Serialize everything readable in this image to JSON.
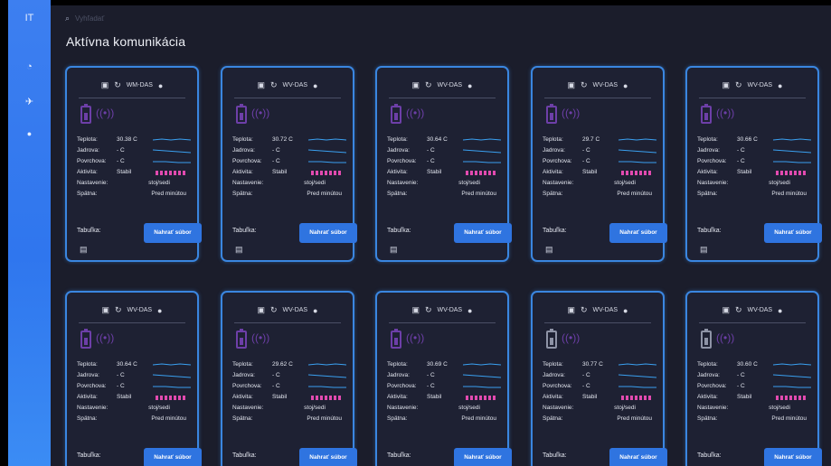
{
  "sidebar": {
    "logo": "IT",
    "items": [
      {
        "icon": "chart-icon",
        "glyph": "◔"
      },
      {
        "icon": "plane-icon",
        "glyph": "✈"
      },
      {
        "icon": "microphone-icon",
        "glyph": "●"
      }
    ]
  },
  "search": {
    "glyph": "⌕",
    "placeholder": "Vyhľadať"
  },
  "page_title": "Aktívna komunikácia",
  "labels": {
    "temp": "Teplota:",
    "jadrova": "Jadrova:",
    "povrchova": "Povrchova:",
    "aktivita": "Aktivita:",
    "aktivita_val": "Stabil",
    "nastavenie": "Nastavenie:",
    "nastavenie_val": "stoj/sedi",
    "spatna": "Spätna:",
    "spatna_val": "Pred minútou",
    "tabulka": "Tabuľka:",
    "create_button": "Nahrať súbor",
    "unit_dash": "- C"
  },
  "colors": {
    "accent": "#2f74e0",
    "card_border": "#3a86e0",
    "dots": "#e24ab0",
    "device": "#6d3fa8"
  },
  "cards": [
    {
      "id": "WM-DAS",
      "temp": "30.38 C",
      "battery": "purple"
    },
    {
      "id": "WV-DAS",
      "temp": "30.72 C",
      "battery": "purple"
    },
    {
      "id": "WV-DAS",
      "temp": "30.64 C",
      "battery": "purple"
    },
    {
      "id": "WV-DAS",
      "temp": "29.7 C",
      "battery": "purple"
    },
    {
      "id": "WV-DAS",
      "temp": "30.66 C",
      "battery": "purple"
    },
    {
      "id": "WV-DAS",
      "temp": "30.64 C",
      "battery": "purple"
    },
    {
      "id": "WV-DAS",
      "temp": "29.62 C",
      "battery": "purple"
    },
    {
      "id": "WV-DAS",
      "temp": "30.69 C",
      "battery": "purple"
    },
    {
      "id": "WV-DAS",
      "temp": "30.77 C",
      "battery": "gray"
    },
    {
      "id": "WV-DAS",
      "temp": "30.60 C",
      "battery": "gray"
    }
  ]
}
